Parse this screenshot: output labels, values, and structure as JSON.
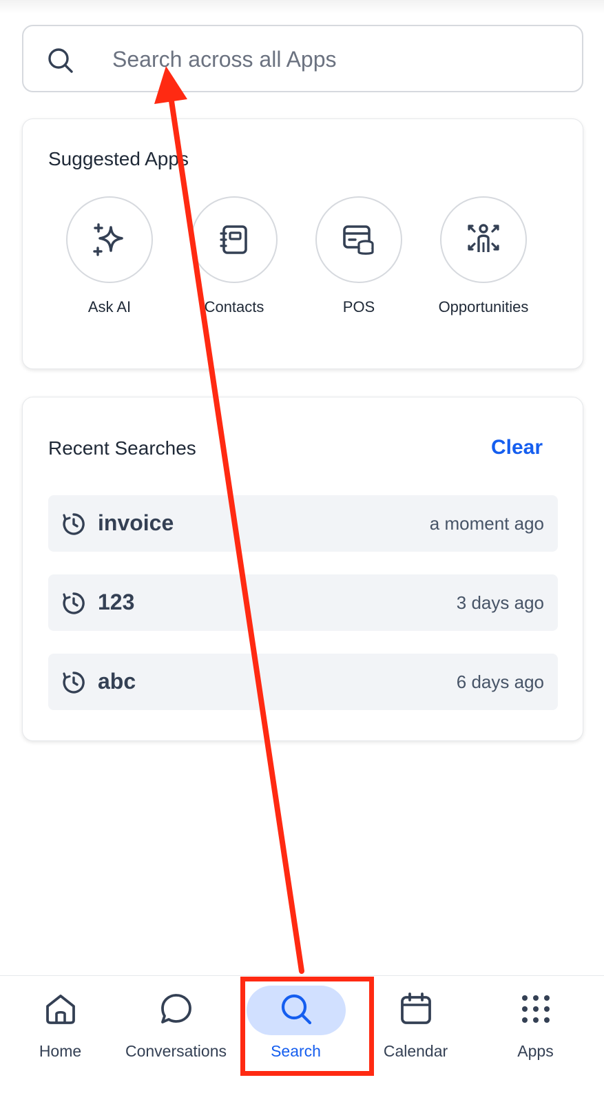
{
  "search": {
    "placeholder": "Search across all Apps",
    "icon": "search-icon"
  },
  "suggested": {
    "title": "Suggested Apps",
    "apps": [
      {
        "label": "Ask AI",
        "icon": "sparkles-icon"
      },
      {
        "label": "Contacts",
        "icon": "contact-book-icon"
      },
      {
        "label": "POS",
        "icon": "pos-register-icon"
      },
      {
        "label": "Opportunities",
        "icon": "opportunities-icon"
      }
    ]
  },
  "recent": {
    "title": "Recent Searches",
    "clear_label": "Clear",
    "items": [
      {
        "term": "invoice",
        "time": "a moment ago"
      },
      {
        "term": "123",
        "time": "3 days ago"
      },
      {
        "term": "abc",
        "time": "6 days ago"
      }
    ]
  },
  "nav": {
    "items": [
      {
        "label": "Home",
        "icon": "home-icon"
      },
      {
        "label": "Conversations",
        "icon": "chat-bubble-icon"
      },
      {
        "label": "Search",
        "icon": "search-icon",
        "active": true
      },
      {
        "label": "Calendar",
        "icon": "calendar-icon"
      },
      {
        "label": "Apps",
        "icon": "apps-grid-icon"
      }
    ]
  },
  "colors": {
    "accent": "#155eef",
    "active_pill": "#d1e0ff",
    "annotation": "#ff2a12",
    "row_bg": "#f2f4f7"
  }
}
